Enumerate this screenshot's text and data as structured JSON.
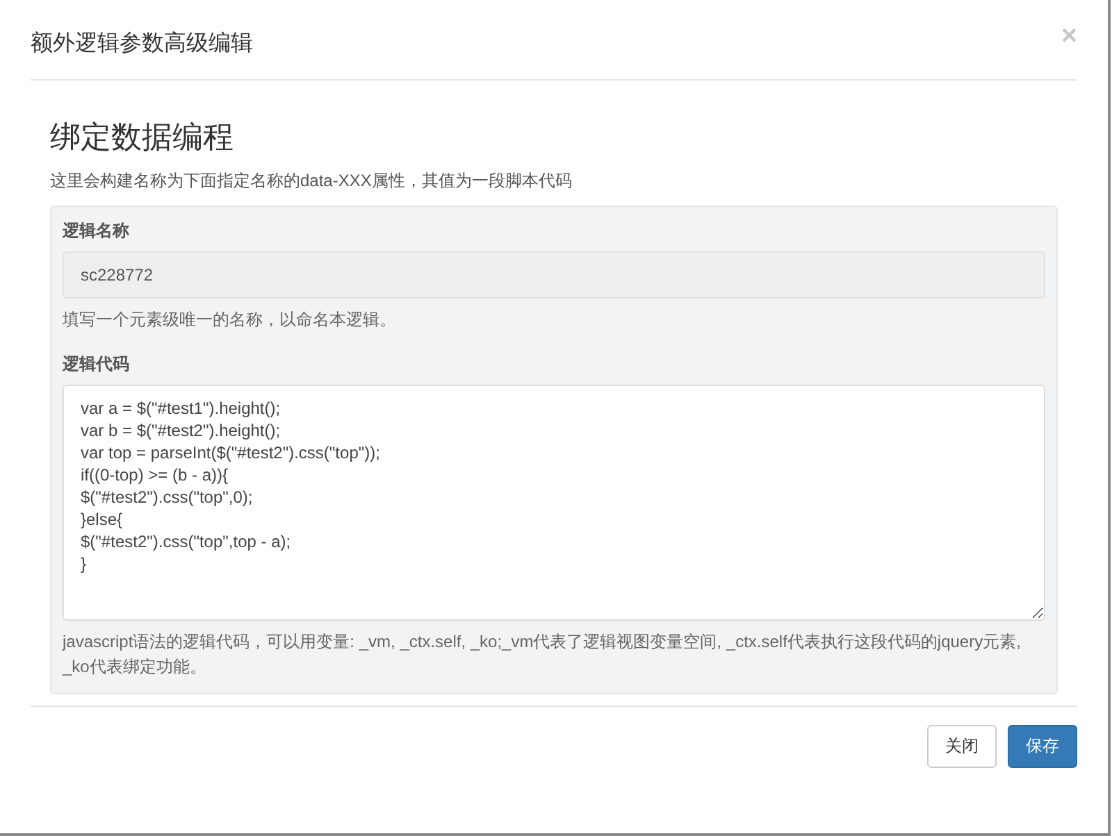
{
  "dialog": {
    "title": "额外逻辑参数高级编辑",
    "close_icon": "×"
  },
  "section": {
    "heading": "绑定数据编程",
    "description": "这里会构建名称为下面指定名称的data-XXX属性，其值为一段脚本代码"
  },
  "fields": [
    {
      "kind": "input",
      "label": "逻辑名称",
      "value": "sc228772",
      "readonly": true,
      "help": "填写一个元素级唯一的名称，以命名本逻辑。"
    },
    {
      "kind": "textarea",
      "label": "逻辑代码",
      "value": "var a = $(\"#test1\").height();\nvar b = $(\"#test2\").height();\nvar top = parseInt($(\"#test2\").css(\"top\"));\nif((0-top) >= (b - a)){\n$(\"#test2\").css(\"top\",0);\n}else{\n$(\"#test2\").css(\"top\",top - a);\n}",
      "help": "javascript语法的逻辑代码，可以用变量: _vm, _ctx.self, _ko;_vm代表了逻辑视图变量空间, _ctx.self代表执行这段代码的jquery元素, _ko代表绑定功能。"
    }
  ],
  "buttons": [
    {
      "label": "关闭",
      "kind": "default"
    },
    {
      "label": "保存",
      "kind": "primary"
    }
  ]
}
